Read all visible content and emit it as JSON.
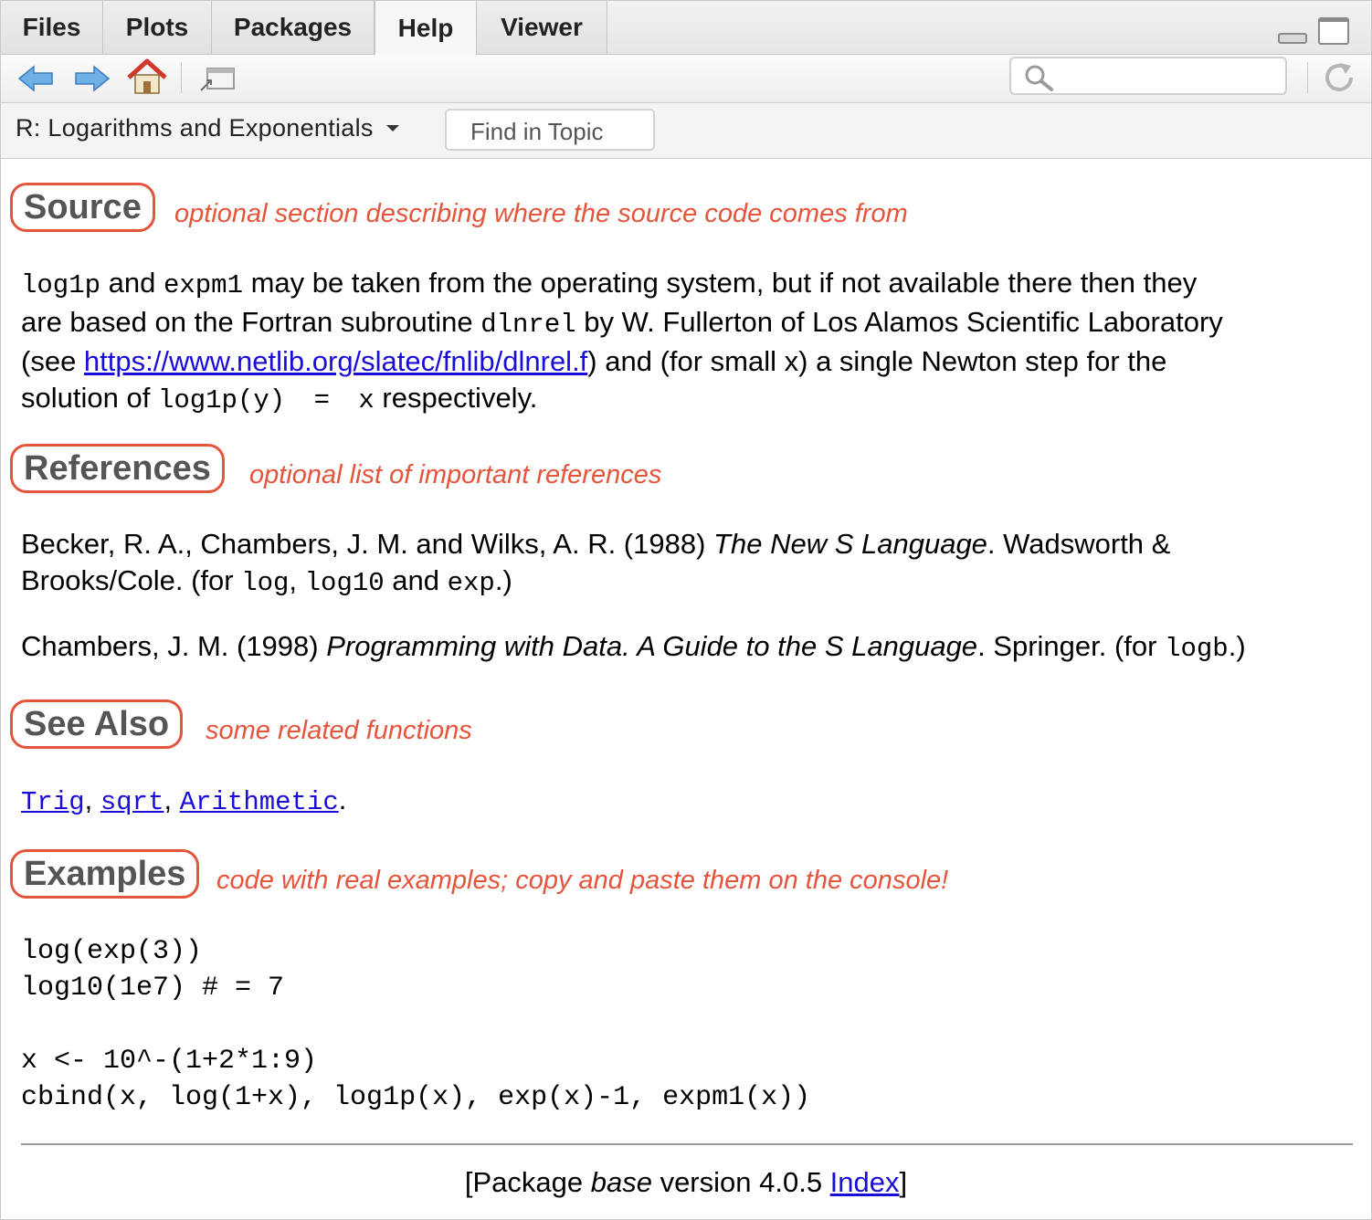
{
  "tabs": [
    {
      "label": "Files",
      "active": false
    },
    {
      "label": "Plots",
      "active": false
    },
    {
      "label": "Packages",
      "active": false
    },
    {
      "label": "Help",
      "active": true
    },
    {
      "label": "Viewer",
      "active": false
    }
  ],
  "toolbar": {
    "search_placeholder": ""
  },
  "topic": {
    "title": "R: Logarithms and Exponentials",
    "find_placeholder": "Find in Topic"
  },
  "sections": {
    "source": {
      "heading": "Source",
      "note": "optional section describing where the source code comes from",
      "text": {
        "log1p": "log1p",
        "and1": " and ",
        "expm1": "expm1",
        "t1": " may be taken from the operating system, but if not available there then they",
        "t2": "are based on the Fortran subroutine ",
        "dlnrel": "dlnrel",
        "t3": " by W. Fullerton of Los Alamos Scientific Laboratory",
        "t4": "(see ",
        "url": "https://www.netlib.org/slatec/fnlib/dlnrel.f",
        "t5": ") and (for small x) a single Newton step for the",
        "t6": "solution of ",
        "eq": "log1p(y) = x",
        "t7": " respectively."
      }
    },
    "references": {
      "heading": "References",
      "note": "optional list of important references",
      "ref1": {
        "a": "Becker, R. A., Chambers, J. M. and Wilks, A. R. (1988) ",
        "title": "The New S Language",
        "b": ". Wadsworth &",
        "c": "Brooks/Cole. (for ",
        "log": "log",
        "comma": ", ",
        "log10": "log10",
        "and": " and ",
        "exp": "exp",
        "end": ".)"
      },
      "ref2": {
        "a": "Chambers, J. M. (1998) ",
        "title": "Programming with Data. A Guide to the S Language",
        "b": ". Springer. (for ",
        "logb": "logb",
        "end": ".)"
      }
    },
    "see_also": {
      "heading": "See Also",
      "note": "some related functions",
      "links": [
        "Trig",
        "sqrt",
        "Arithmetic"
      ],
      "sep": ", ",
      "end": "."
    },
    "examples": {
      "heading": "Examples",
      "note": "code with real examples; copy and paste them on the console!",
      "code": "log(exp(3))\nlog10(1e7) # = 7\n\nx <- 10^-(1+2*1:9)\ncbind(x, log(1+x), log1p(x), exp(x)-1, expm1(x))"
    }
  },
  "footer": {
    "open": "[Package ",
    "pkg": "base",
    "version": " version 4.0.5 ",
    "index": "Index",
    "close": "]"
  },
  "colors": {
    "annotation": "#e4553c",
    "link": "#1a0dd9",
    "nav_arrow": "#5aa2dd",
    "home_roof": "#d0382b"
  }
}
